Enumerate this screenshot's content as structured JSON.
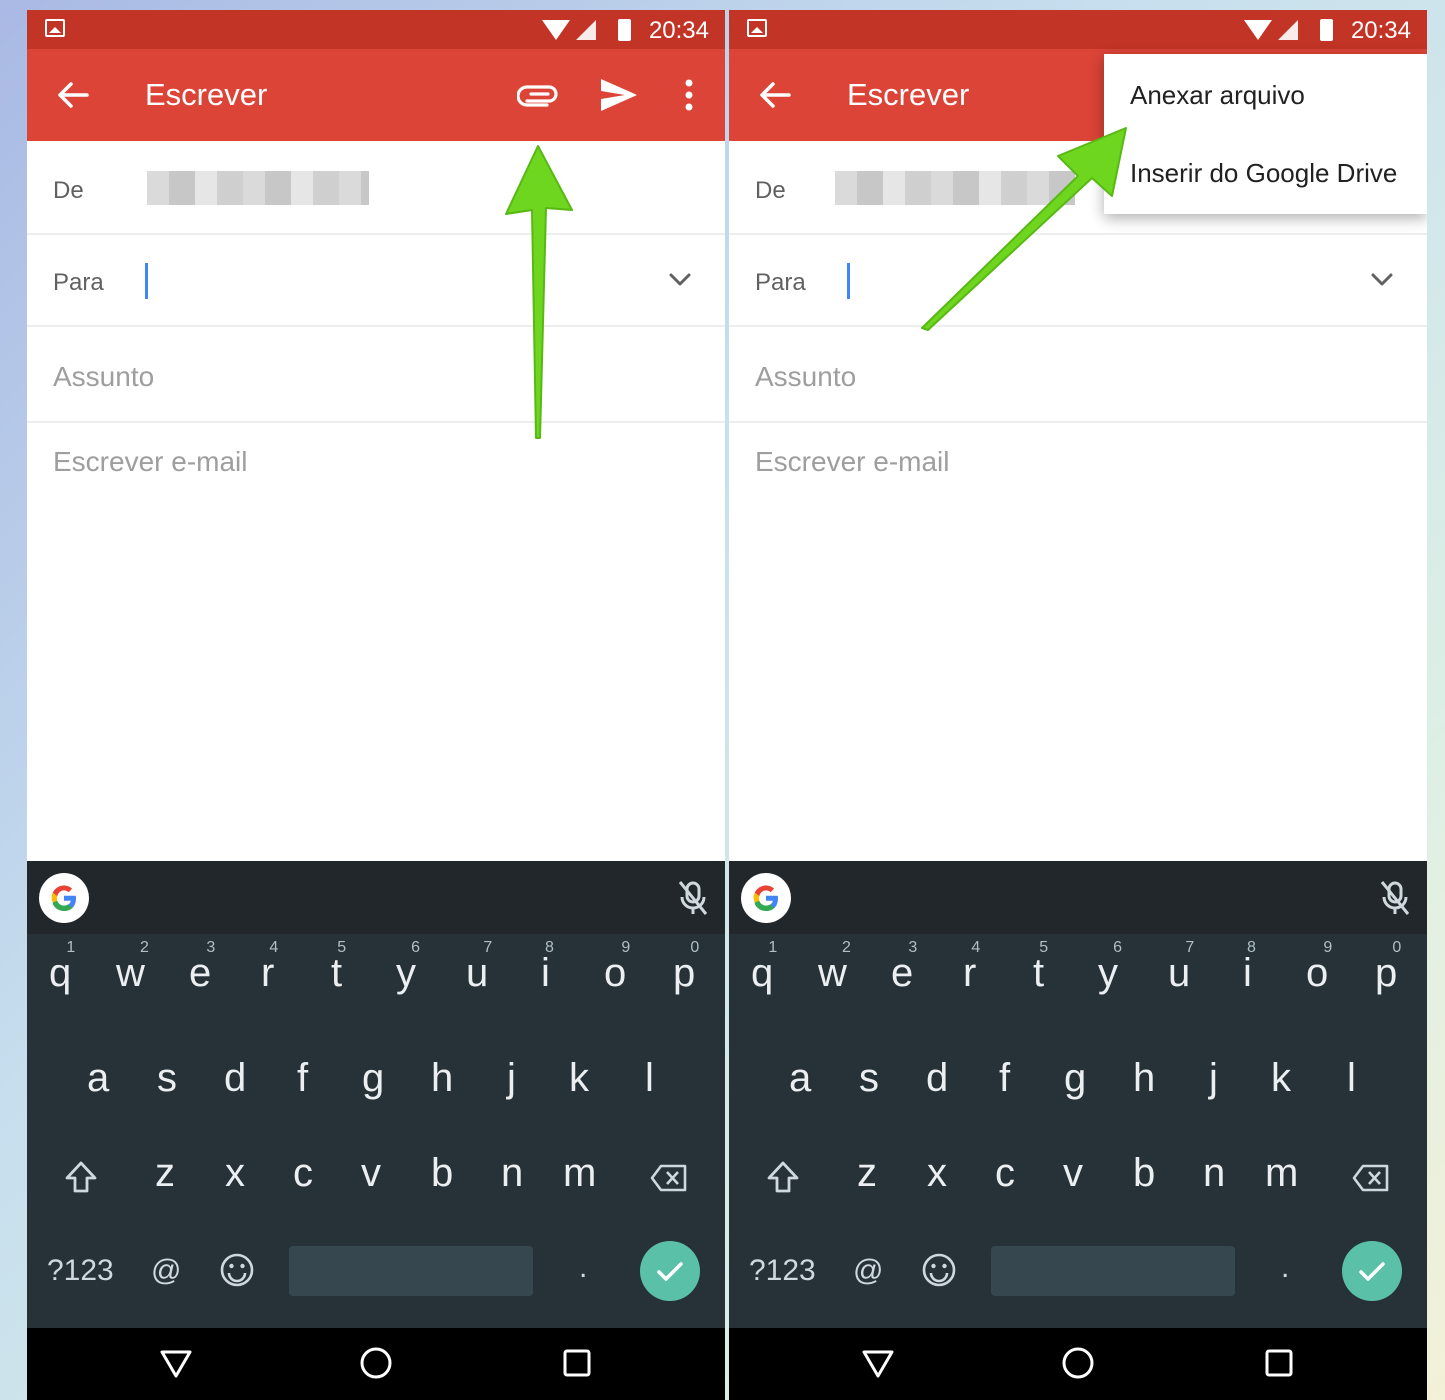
{
  "panels": [
    {
      "status_time": "20:34",
      "title": "Escrever",
      "from_label": "De",
      "to_label": "Para",
      "subject_placeholder": "Assunto",
      "body_placeholder": "Escrever e-mail"
    },
    {
      "status_time": "20:34",
      "title": "Escrever",
      "from_label": "De",
      "to_label": "Para",
      "subject_placeholder": "Assunto",
      "body_placeholder": "Escrever e-mail",
      "menu": {
        "items": [
          "Anexar arquivo",
          "Inserir do Google Drive"
        ]
      }
    }
  ],
  "keyboard": {
    "row1": [
      "q",
      "w",
      "e",
      "r",
      "t",
      "y",
      "u",
      "i",
      "o",
      "p"
    ],
    "row1_hints": [
      "1",
      "2",
      "3",
      "4",
      "5",
      "6",
      "7",
      "8",
      "9",
      "0"
    ],
    "row2": [
      "a",
      "s",
      "d",
      "f",
      "g",
      "h",
      "j",
      "k",
      "l"
    ],
    "row3": [
      "z",
      "x",
      "c",
      "v",
      "b",
      "n",
      "m"
    ],
    "symbols_label": "?123",
    "at_label": "@",
    "period_label": "."
  },
  "colors": {
    "status_bar": "#c23426",
    "app_bar": "#db4437",
    "keyboard_bg": "#263238",
    "enter_key": "#5bc0a8",
    "arrow": "#6fd620",
    "cursor": "#4285f4"
  },
  "icons": [
    "back-arrow-icon",
    "paperclip-icon",
    "send-icon",
    "more-vert-icon",
    "chevron-down-icon",
    "google-g-icon",
    "mic-off-icon",
    "shift-icon",
    "backspace-icon",
    "emoji-icon",
    "checkmark-icon",
    "nav-back-icon",
    "nav-home-icon",
    "nav-recent-icon"
  ]
}
